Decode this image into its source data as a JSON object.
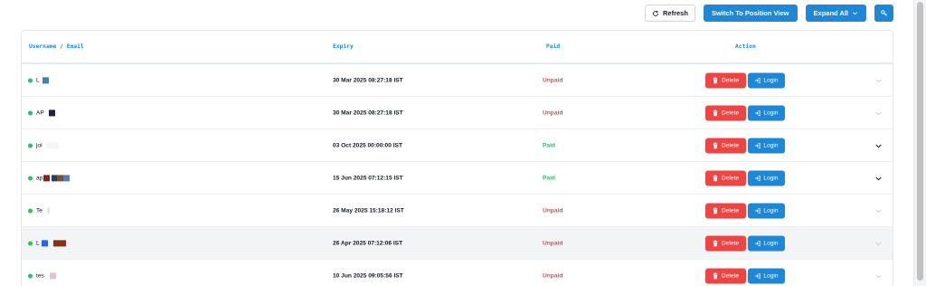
{
  "toolbar": {
    "refresh_label": "Refresh",
    "switch_label": "Switch To Position View",
    "expand_label": "Expand All"
  },
  "table": {
    "headers": {
      "user": "Username / Email",
      "expiry": "Expiry",
      "paid": "Paid",
      "action": "Action"
    },
    "delete_label": "Delete",
    "login_label": "Login",
    "rows": [
      {
        "user": "L",
        "expiry": "30 Mar 2025 08:27:18 IST",
        "paid": "Unpaid"
      },
      {
        "user": "AP",
        "expiry": "30 Mar 2025 08:27:18 IST",
        "paid": "Unpaid"
      },
      {
        "user": "jol",
        "expiry": "03 Oct 2025 00:00:00 IST",
        "paid": "Paid"
      },
      {
        "user": "ap",
        "expiry": "15 Jun 2025 07:12:15 IST",
        "paid": "Paid"
      },
      {
        "user": "Te",
        "expiry": "26 May 2025 15:18:12 IST",
        "paid": "Unpaid"
      },
      {
        "user": "L",
        "expiry": "26 Apr 2025 07:12:06 IST",
        "paid": "Unpaid"
      },
      {
        "user": "tes",
        "expiry": "10 Jun 2025 09:05:56 IST",
        "paid": "Unpaid"
      }
    ]
  },
  "colors": {
    "accent": "#1e88d6",
    "danger": "#ef4444",
    "success": "#22c55e"
  },
  "icons": {
    "refresh": "refresh-icon",
    "chevron": "chevron-down-icon",
    "settings": "options-icon",
    "trash": "trash-icon",
    "login": "login-icon",
    "status": "online-dot"
  }
}
